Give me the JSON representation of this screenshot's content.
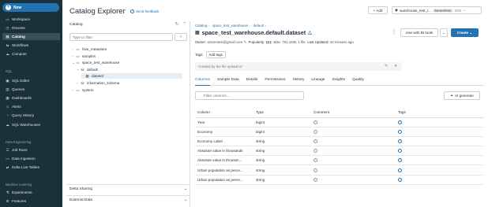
{
  "sidebar": {
    "new_label": "New",
    "items": [
      {
        "label": "Workspace",
        "icon": "folder-icon",
        "glyph": "▭"
      },
      {
        "label": "Recents",
        "icon": "clock-icon",
        "glyph": "◷"
      },
      {
        "label": "Catalog",
        "icon": "catalog-icon",
        "glyph": "▤"
      },
      {
        "label": "Workflows",
        "icon": "workflows-icon",
        "glyph": "⇆"
      },
      {
        "label": "Compute",
        "icon": "cloud-icon",
        "glyph": "☁"
      }
    ],
    "sql_section": "SQL",
    "sql_items": [
      {
        "label": "SQL Editor",
        "icon": "editor-icon",
        "glyph": "▣"
      },
      {
        "label": "Queries",
        "icon": "queries-icon",
        "glyph": "▥"
      },
      {
        "label": "Dashboards",
        "icon": "dashboards-icon",
        "glyph": "▦"
      },
      {
        "label": "Alerts",
        "icon": "bell-icon",
        "glyph": "⚠"
      },
      {
        "label": "Query History",
        "icon": "history-icon",
        "glyph": "◔"
      },
      {
        "label": "SQL Warehouses",
        "icon": "warehouse-icon",
        "glyph": "☁"
      }
    ],
    "de_section": "Data Engineering",
    "de_items": [
      {
        "label": "Job Runs",
        "icon": "job-runs-icon",
        "glyph": "☰"
      },
      {
        "label": "Data Ingestion",
        "icon": "ingestion-icon",
        "glyph": "▭"
      },
      {
        "label": "Delta Live Tables",
        "icon": "delta-icon",
        "glyph": "⇄"
      }
    ],
    "ml_section": "Machine Learning",
    "ml_items": [
      {
        "label": "Experiments",
        "icon": "experiments-icon",
        "glyph": "⚗"
      },
      {
        "label": "Features",
        "icon": "features-icon",
        "glyph": "⚙"
      }
    ]
  },
  "header": {
    "title": "Catalog Explorer",
    "feedback": "Send feedback",
    "add_label": "+ Add",
    "warehouse": "warehouse_test_i...",
    "serverless": "Serverless",
    "size": "2XS"
  },
  "catalog_panel": {
    "title": "Catalog",
    "filter_placeholder": "Type to filter",
    "tree": [
      {
        "label": "hive_metastore",
        "chev": "›",
        "glyph": "▭",
        "indent": 0
      },
      {
        "label": "samples",
        "chev": "›",
        "glyph": "▭",
        "indent": 0
      },
      {
        "label": "space_test_warehouse",
        "chev": "⌄",
        "glyph": "▭",
        "indent": 0
      },
      {
        "label": "default",
        "chev": "⌄",
        "glyph": "⛁",
        "indent": 1
      },
      {
        "label": "dataset",
        "chev": "",
        "glyph": "▦",
        "indent": 2
      },
      {
        "label": "information_schema",
        "chev": "›",
        "glyph": "⛁",
        "indent": 1
      },
      {
        "label": "system",
        "chev": "›",
        "glyph": "▭",
        "indent": 0
      }
    ],
    "delta_sharing": "Delta Sharing",
    "external_data": "External Data"
  },
  "breadcrumb": [
    "Catalog",
    "space_test_warehouse",
    "default"
  ],
  "dataset": {
    "title": "space_test_warehouse.default.dataset",
    "owner_label": "Owner:",
    "owner": "azurestest@gmail.com",
    "popularity_label": "Popularity:",
    "size_label": "Size:",
    "size": "791.1KiB, 1 file",
    "updated_label": "Last Updated:",
    "updated": "42 minutes ago",
    "tags_label": "Tags:",
    "add_tags": "Add tags",
    "description": "Created by the file upload UI",
    "open_bi": "Use with BI tools",
    "create": "Create"
  },
  "tabs": [
    "Columns",
    "Sample Data",
    "Details",
    "Permissions",
    "History",
    "Lineage",
    "Insights",
    "Quality"
  ],
  "columns_view": {
    "filter_placeholder": "Filter columns...",
    "ai_generate": "AI generate",
    "headers": [
      "Column",
      "Type",
      "Comment",
      "Tags"
    ],
    "rows": [
      {
        "name": "Year",
        "type": "bigint"
      },
      {
        "name": "Economy",
        "type": "bigint"
      },
      {
        "name": "Economy Label",
        "type": "string"
      },
      {
        "name": "Absolute value in thousands",
        "type": "string"
      },
      {
        "name": "Absolute value in thousan...",
        "type": "string"
      },
      {
        "name": "Urban population as perce...",
        "type": "string"
      },
      {
        "name": "Urban population as perce...",
        "type": "string"
      }
    ]
  },
  "colors": {
    "accent": "#2272b4",
    "sidebar": "#1b3139"
  }
}
